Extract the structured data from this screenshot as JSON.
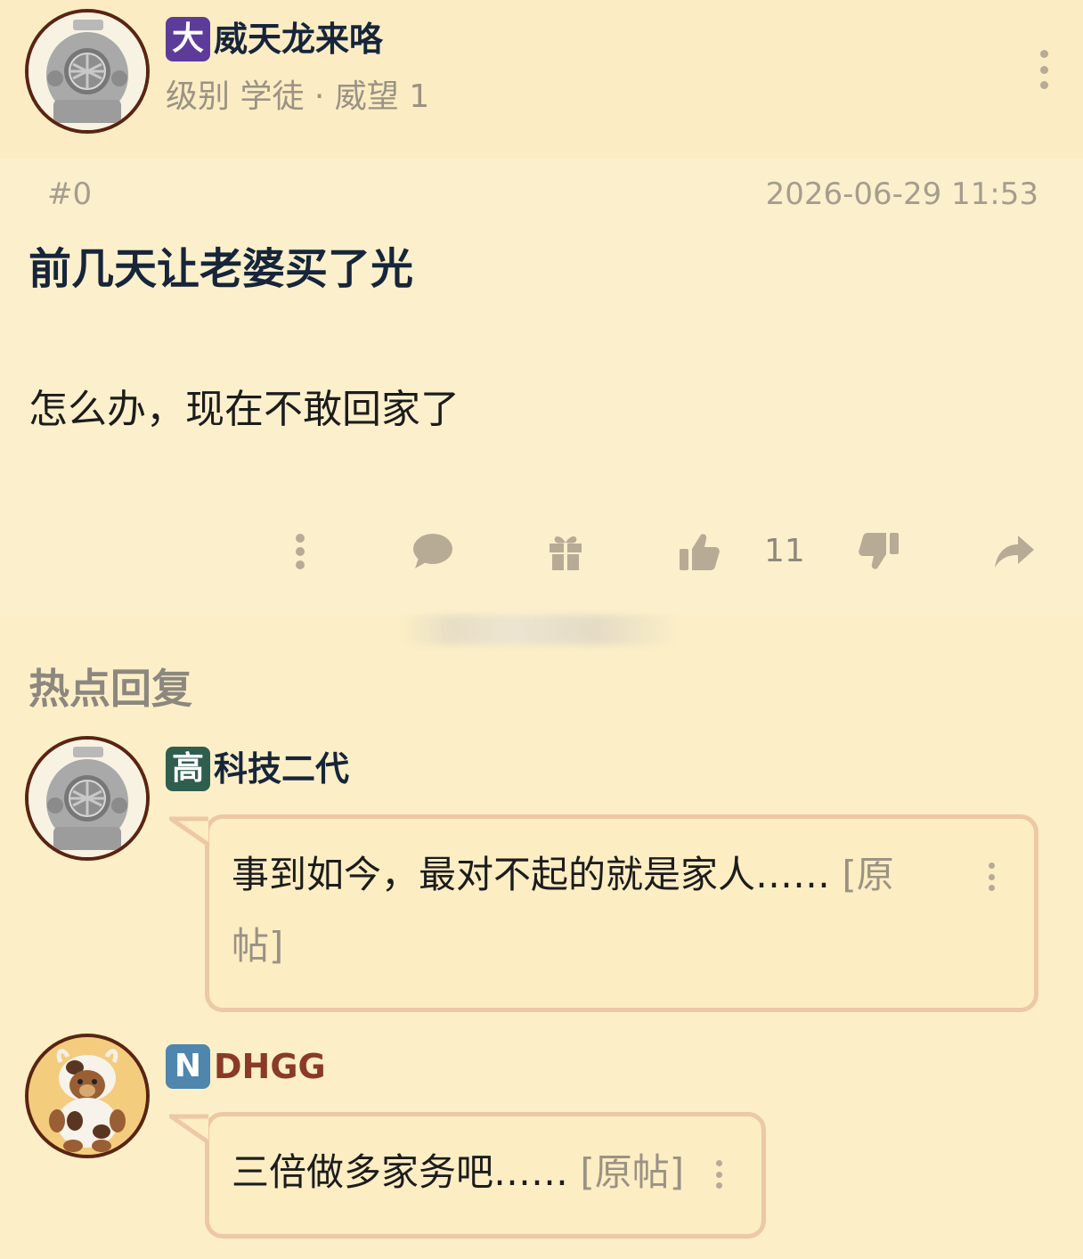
{
  "post": {
    "author": {
      "badge": "大",
      "badge_color": "#5d3b9a",
      "name": "威天龙来咯",
      "name_color": "#16253a",
      "meta": "级别 学徒 · 威望 1"
    },
    "floor": "#0",
    "timestamp": "2026-06-29 11:53",
    "title": "前几天让老婆买了光",
    "body": "怎么办，现在不敢回家了",
    "actions": {
      "like_count": "11",
      "icons": [
        "more-icon",
        "comment-icon",
        "gift-icon",
        "thumbs-up-icon",
        "thumbs-down-icon",
        "share-icon"
      ]
    }
  },
  "hot_replies": {
    "title": "热点回复",
    "items": [
      {
        "badge": "高",
        "badge_color": "#2f5e4e",
        "name": "科技二代",
        "name_color": "#16253a",
        "text_line1": "事到如今，最对不起的就是家人……",
        "link_part1": " [原",
        "link_part2": "帖]"
      },
      {
        "badge": "N",
        "badge_color": "#4e86ae",
        "name": "DHGG",
        "name_color": "#8a3a26",
        "text_line1": "三倍做多家务吧……",
        "link": " [原帖]"
      }
    ]
  },
  "colors": {
    "background": "#fcefc7",
    "bubble_border": "#ecc8a6",
    "muted_text": "#9a9284",
    "icon_grey": "#b7ab96"
  }
}
